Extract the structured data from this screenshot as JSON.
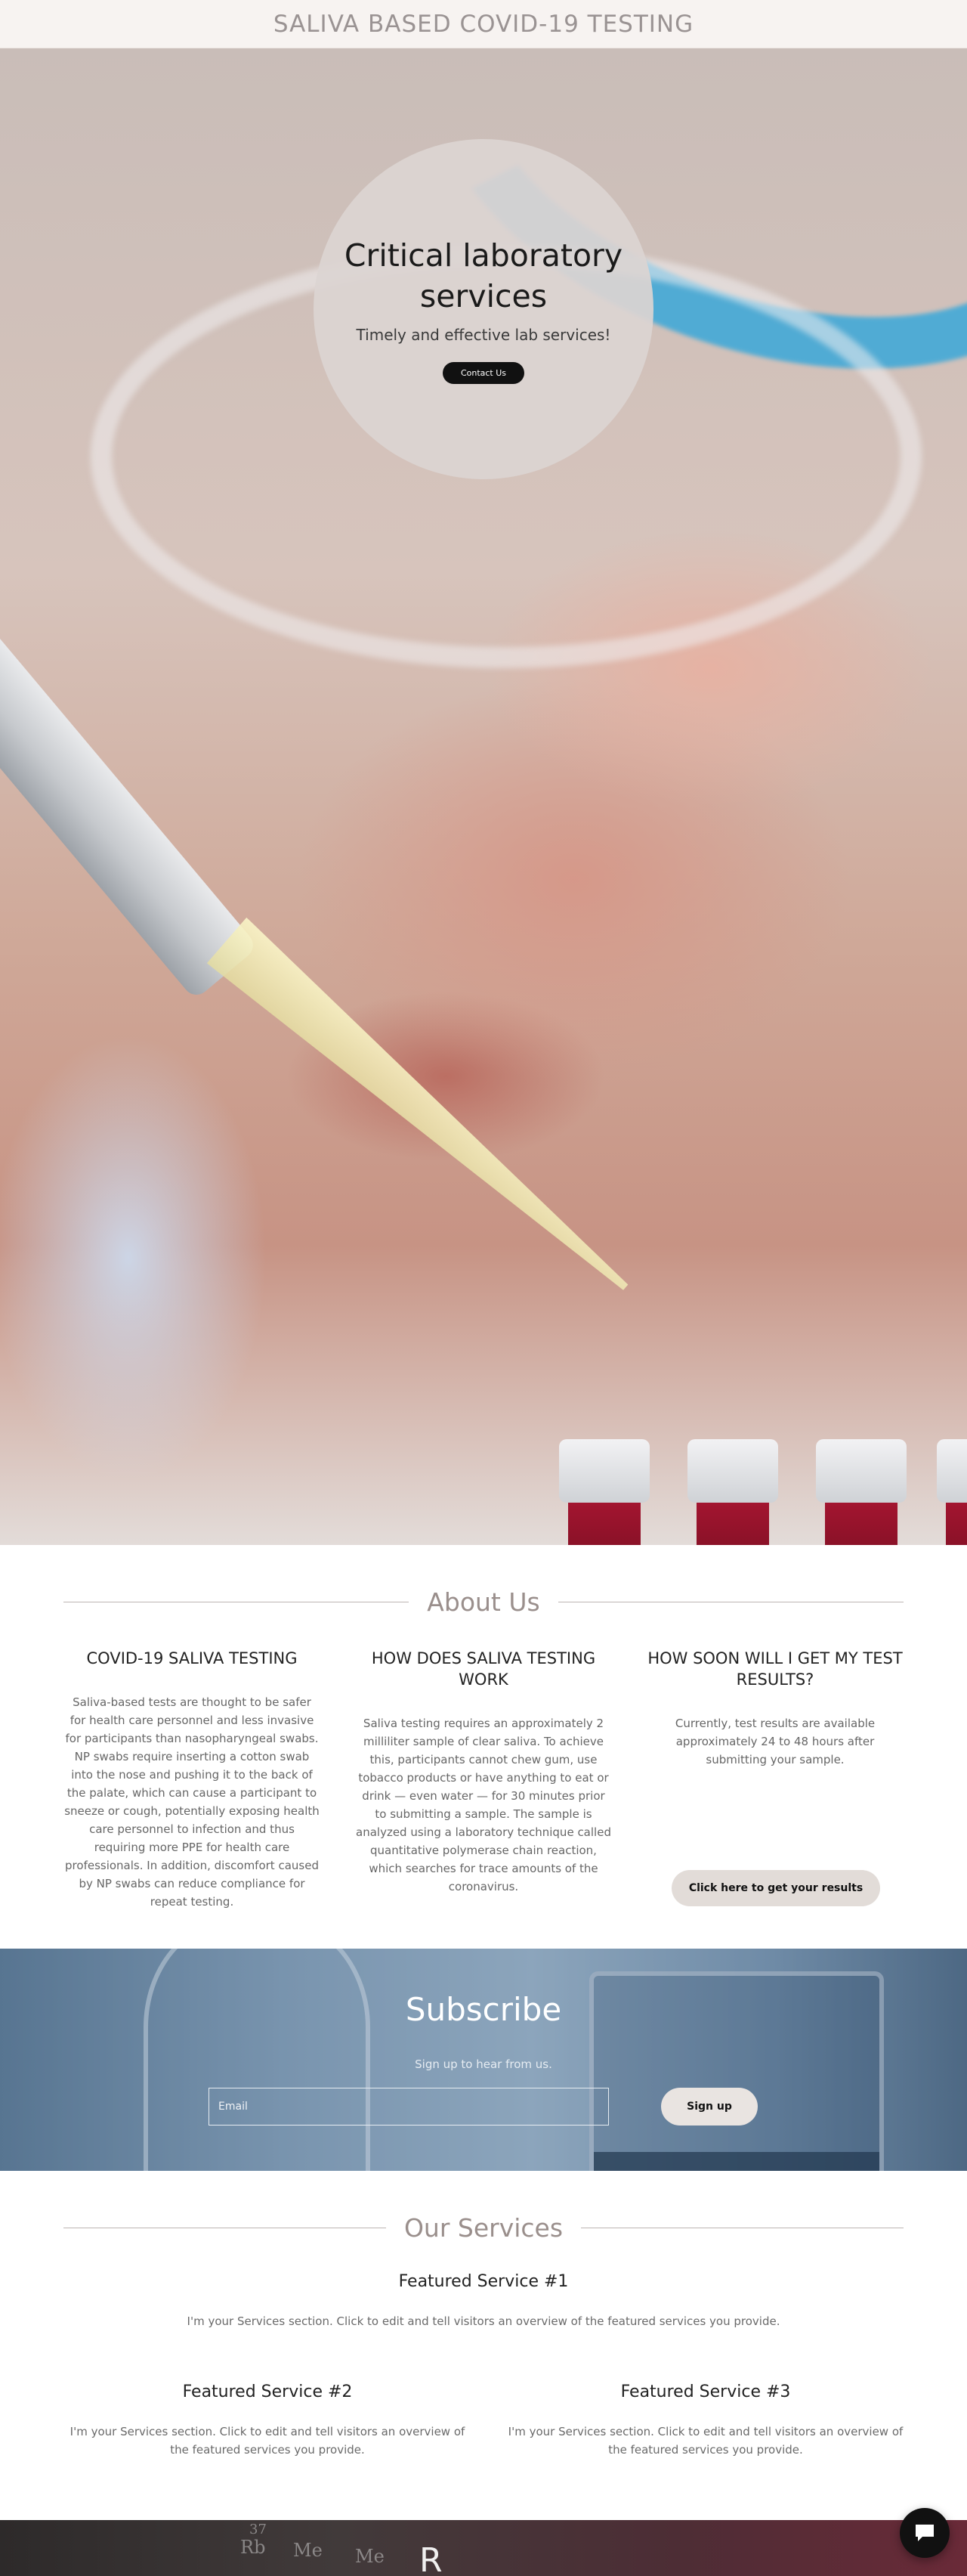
{
  "header": {
    "title": "SALIVA BASED COVID-19 TESTING"
  },
  "hero": {
    "title": "Critical laboratory services",
    "subtitle": "Timely and effective lab services!",
    "cta_label": "Contact Us"
  },
  "about": {
    "heading": "About Us",
    "columns": [
      {
        "title": "COVID-19 SALIVA TESTING",
        "body": "Saliva-based tests are thought to be safer for health care personnel and less invasive for participants than nasopharyngeal swabs. NP swabs require inserting a cotton swab into the nose and pushing it to the back of the palate, which can cause a participant to sneeze or cough, potentially exposing health care personnel to infection and thus requiring more PPE for health care professionals. In addition, discomfort caused by NP swabs can reduce compliance for repeat testing."
      },
      {
        "title": "HOW DOES SALIVA TESTING WORK",
        "body": "Saliva testing requires an approximately 2 milliliter sample of clear saliva. To achieve this, participants cannot chew gum, use tobacco products or have anything to eat or drink — even water — for 30 minutes prior to submitting a sample. The sample is analyzed using a laboratory technique called quantitative polymerase chain reaction, which searches for trace amounts of the coronavirus."
      },
      {
        "title": "HOW SOON WILL I GET MY TEST RESULTS?",
        "body": "Currently, test results are available approximately 24 to 48 hours after submitting your sample.",
        "button_label": "Click here to get your results"
      }
    ]
  },
  "subscribe": {
    "title": "Subscribe",
    "text": "Sign up to hear from us.",
    "email_placeholder": "Email",
    "button_label": "Sign up"
  },
  "services": {
    "heading": "Our Services",
    "items": [
      {
        "title": "Featured Service #1",
        "body": "I'm your Services section. Click to edit and tell visitors an overview of the featured services you provide."
      },
      {
        "title": "Featured Service #2",
        "body": "I'm your Services section. Click to edit and tell visitors an overview of the featured services you provide."
      },
      {
        "title": "Featured Service #3",
        "body": "I'm your Services section. Click to edit and tell visitors an overview of the featured services you provide."
      }
    ]
  },
  "bottom_banner": {
    "fragments": [
      "37",
      "Rb",
      "Me",
      "Me"
    ],
    "heading_fragment": "R"
  },
  "chat": {
    "icon": "chat-icon"
  },
  "colors": {
    "accent_dark": "#111111",
    "heading_muted": "#9a8f8c",
    "header_bg": "#f7f3f1"
  }
}
